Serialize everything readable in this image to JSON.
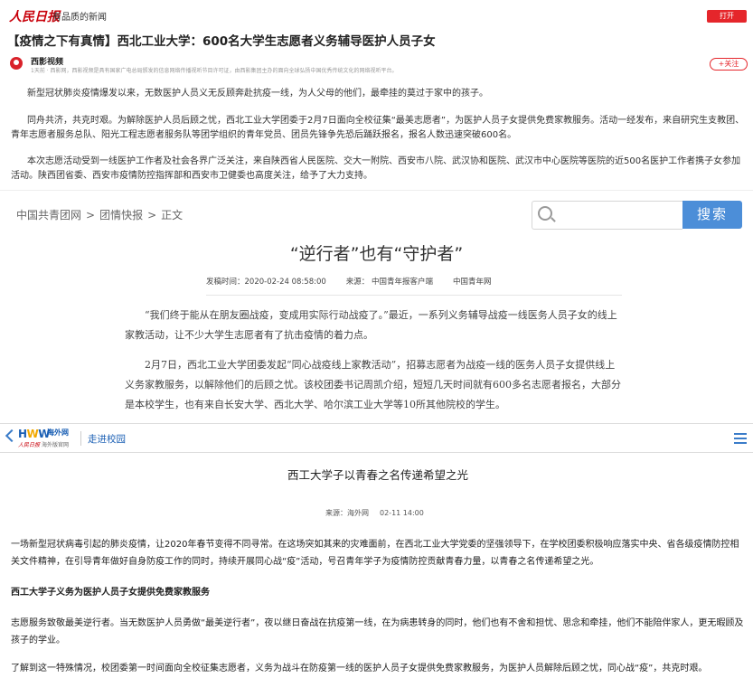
{
  "people_daily": {
    "logo": "人民日报",
    "slogan": "有品质的新闻",
    "open_button": "打开",
    "title": "【疫情之下有真情】西北工业大学：600名大学生志愿者义务辅导医护人员子女",
    "source_name": "西影视频",
    "source_desc": "1天前 · 西影网，西影视频是具有国家广电总局颁发的信息网络传播视听节目许可证，由西影集团主办的面向全球弘扬中国优秀传统文化的网络视听平台。",
    "follow_button": "+关注",
    "paragraphs": [
      "新型冠状肺炎疫情爆发以来，无数医护人员义无反顾奔赴抗疫一线，为人父母的他们，最牵挂的莫过于家中的孩子。",
      "同舟共济，共克时艰。为解除医护人员后顾之忧，西北工业大学团委于2月7日面向全校征集“最美志愿者”，为医护人员子女提供免费家教服务。活动一经发布，来自研究生支教团、青年志愿者服务总队、阳光工程志愿者服务队等团学组织的青年党员、团员先锋争先恐后踊跃报名，报名人数迅速突破600名。",
      "本次志愿活动受到一线医护工作者及社会各界广泛关注，来自陕西省人民医院、交大一附院、西安市八院、武汉协和医院、武汉市中心医院等医院的近500名医护工作者携子女参加活动。陕西团省委、西安市疫情防控指挥部和西安市卫健委也高度关注，给予了大力支持。"
    ]
  },
  "youth_net": {
    "breadcrumb": [
      "中国共青团网",
      "团情快报",
      "正文"
    ],
    "breadcrumb_sep": ">",
    "search_placeholder": "",
    "search_button": "搜索",
    "title": "“逆行者”也有“守护者”",
    "meta_time": "发稿时间：2020-02-24 08:58:00",
    "meta_source": "来源：  中国青年报客户端",
    "meta_site": "中国青年网",
    "paragraphs": [
      "“我们终于能从在朋友圈战疫，变成用实际行动战疫了。”最近，一系列义务辅导战疫一线医务人员子女的线上家教活动，让不少大学生志愿者有了抗击疫情的着力点。",
      "2月7日，西北工业大学团委发起“同心战疫线上家教活动”，招募志愿者为战疫一线的医务人员子女提供线上义务家教服务，以解除他们的后顾之忧。该校团委书记周凯介绍，短短几天时间就有600多名志愿者报名，大部分是本校学生，也有来自长安大学、西北大学、哈尔滨工业大学等10所其他院校的学生。"
    ]
  },
  "haiwai": {
    "logo_en_a": "H",
    "logo_en_w": "W",
    "logo_en_b": "W",
    "logo_cn": "海外网",
    "logo_sub_a": "人民日报",
    "logo_sub_b": "海外版官网",
    "section": "走进校园",
    "title": "西工大学子以青春之名传递希望之光",
    "meta_source": "来源：海外网",
    "meta_time": "02-11 14:00",
    "paragraph_1": "一场新型冠状病毒引起的肺炎疫情，让2020年春节变得不同寻常。在这场突如其来的灾难面前，在西北工业大学党委的坚强领导下，在学校团委积极响应落实中央、省各级疫情防控相关文件精神，在引导青年做好自身防疫工作的同时，持续开展同心战“疫”活动，号召青年学子为疫情防控贡献青春力量，以青春之名传递希望之光。",
    "subheading": "西工大学子义务为医护人员子女提供免费家教服务",
    "paragraph_2": "志愿服务致敬最美逆行者。当无数医护人员勇做“最美逆行者”，夜以继日奋战在抗疫第一线，在为病患转身的同时，他们也有不舍和担忧、思念和牵挂，他们不能陪伴家人，更无暇顾及孩子的学业。",
    "paragraph_3": "了解到这一特殊情况，校团委第一时间面向全校征集志愿者，义务为战斗在防疫第一线的医护人员子女提供免费家教服务，为医护人员解除后顾之忧，同心战“疫”，共克时艰。"
  },
  "colors": {
    "brand_red": "#e5262b",
    "search_blue": "#4c8ed8",
    "link_blue": "#1a5fb4"
  }
}
